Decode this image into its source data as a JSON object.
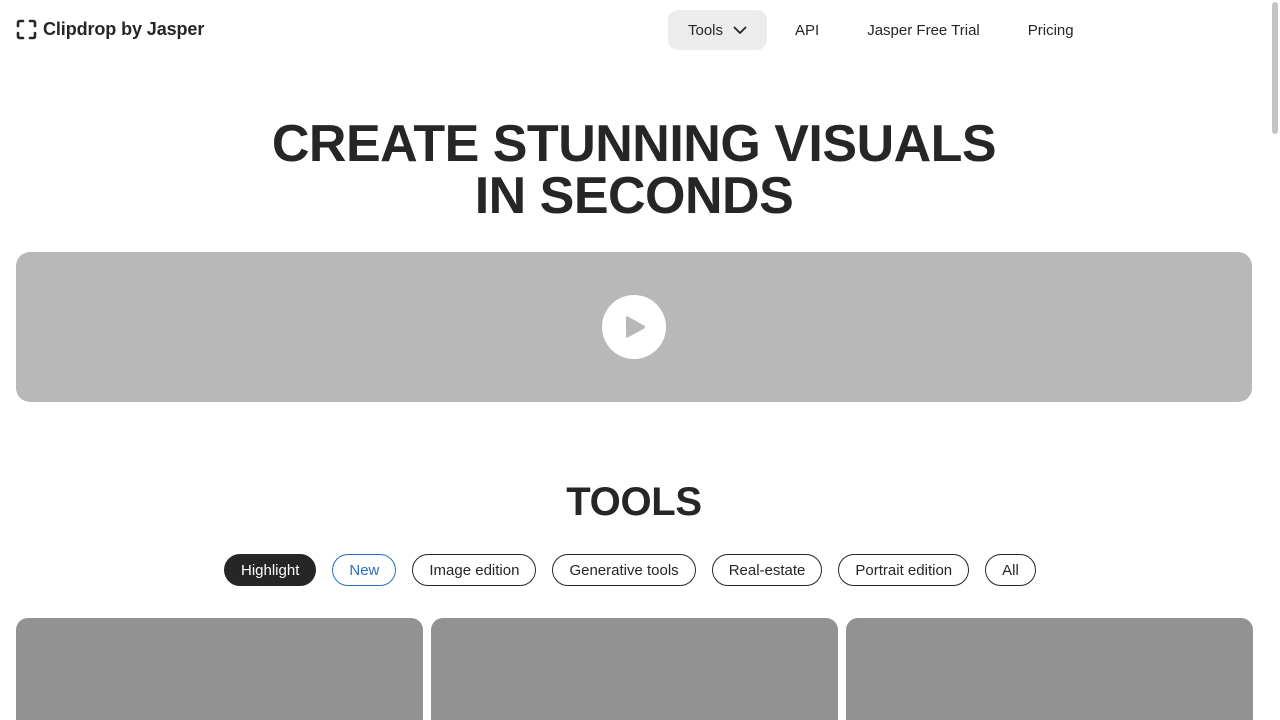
{
  "header": {
    "brand": "Clipdrop by Jasper",
    "nav": [
      {
        "label": "Tools",
        "icon": "chevron-down-icon"
      },
      {
        "label": "API"
      },
      {
        "label": "Jasper Free Trial"
      },
      {
        "label": "Pricing"
      }
    ]
  },
  "hero": {
    "title_line1": "CREATE STUNNING VISUALS",
    "title_line2": "IN SECONDS",
    "video_icon": "play-icon"
  },
  "tools": {
    "title": "TOOLS",
    "filters": [
      "Highlight",
      "New",
      "Image edition",
      "Generative tools",
      "Real-estate",
      "Portrait edition",
      "All"
    ],
    "selected_filter": "Highlight"
  },
  "colors": {
    "text": "#262626",
    "nav_active_bg": "#ececec",
    "video_bg": "#b8b8b8",
    "card_bg": "#929292",
    "new_accent": "#2b6cc4"
  }
}
